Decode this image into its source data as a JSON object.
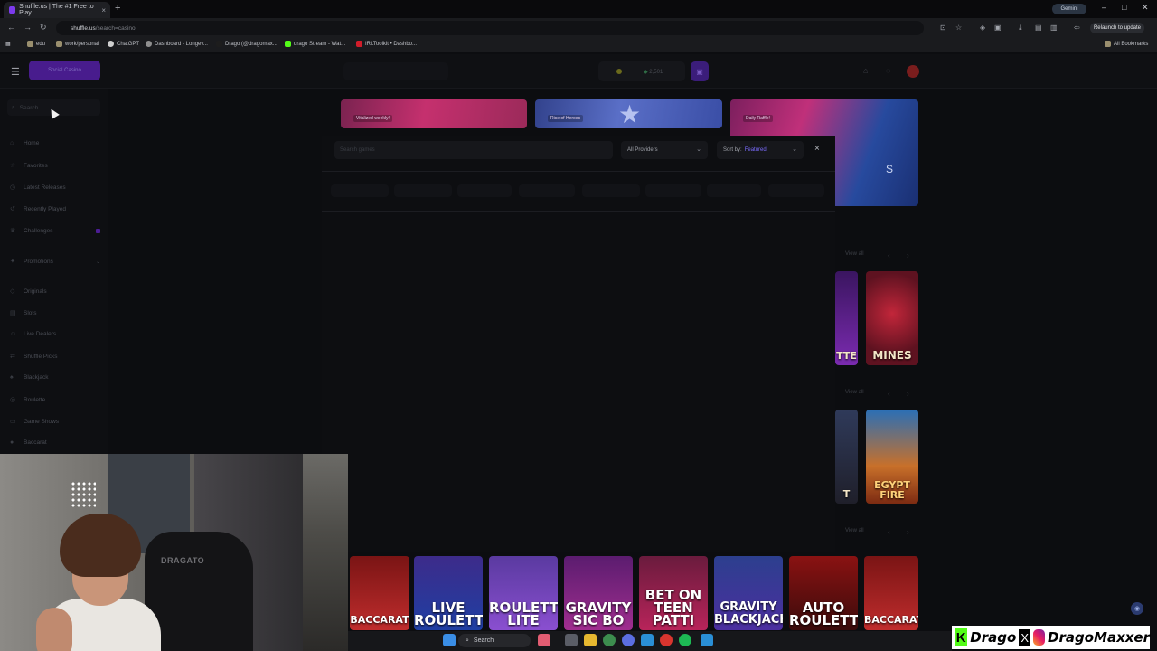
{
  "browser": {
    "tab_title": "Shuffle.us | The #1 Free to Play",
    "tab_close": "×",
    "new_tab": "+",
    "gemini": "Gemini",
    "url_host": "shuffle.us",
    "url_path": "/search=casino",
    "relaunch": "Relaunch to update",
    "bookmarks": [
      {
        "label": "edu"
      },
      {
        "label": "work/personal"
      },
      {
        "label": "ChatGPT"
      },
      {
        "label": "Dashboard - Longev..."
      },
      {
        "label": "Drago (@dragomax..."
      },
      {
        "label": "drago Stream - Wat..."
      },
      {
        "label": "IRLToolkit • Dashbo..."
      }
    ],
    "all_bookmarks": "All Bookmarks"
  },
  "header": {
    "social_button": "Social Casino",
    "balance": "2,501"
  },
  "sidebar": {
    "search_placeholder": "Search",
    "items": [
      {
        "label": "Home",
        "icon": "home-icon"
      },
      {
        "label": "Favorites",
        "icon": "star-icon"
      },
      {
        "label": "Latest Releases",
        "icon": "clock-icon"
      },
      {
        "label": "Recently Played",
        "icon": "history-icon"
      },
      {
        "label": "Challenges",
        "icon": "trophy-icon"
      },
      {
        "label": "Promotions",
        "icon": "gift-icon"
      },
      {
        "label": "Originals",
        "icon": "diamond-icon"
      },
      {
        "label": "Slots",
        "icon": "slots-icon"
      },
      {
        "label": "Live Dealers",
        "icon": "dealer-icon"
      },
      {
        "label": "Shuffle Picks",
        "icon": "shuffle-icon"
      },
      {
        "label": "Blackjack",
        "icon": "cards-icon"
      },
      {
        "label": "Roulette",
        "icon": "roulette-icon"
      },
      {
        "label": "Game Shows",
        "icon": "tv-icon"
      },
      {
        "label": "Baccarat",
        "icon": "chip-icon"
      }
    ]
  },
  "banners": [
    {
      "label": "Vitalized weekly!"
    },
    {
      "label": "Rise of Heroes"
    },
    {
      "label": "Daily Raffle!"
    }
  ],
  "search_overlay": {
    "placeholder": "Search games",
    "providers": "All Providers",
    "sort_label": "Sort by:",
    "sort_value": "Featured",
    "close": "×"
  },
  "sections": [
    {
      "view_all": "View all"
    },
    {
      "view_all": "View all"
    },
    {
      "view_all": "View all"
    }
  ],
  "right_tiles": [
    {
      "text": "TTE"
    },
    {
      "text": "MINES"
    },
    {
      "text": "T"
    },
    {
      "text": "EGYPT FIRE"
    }
  ],
  "bottom_tiles": [
    {
      "text": "BACCARAT"
    },
    {
      "text": "LIVE ROULETTE"
    },
    {
      "text": "ROULETTE LITE"
    },
    {
      "text": "GRAVITY SIC BO"
    },
    {
      "text": "BET ON TEEN PATTI"
    },
    {
      "text": "GRAVITY BLACKJACK"
    },
    {
      "text": "AUTO ROULETTE"
    },
    {
      "text": "BACCARAT"
    }
  ],
  "webcam": {
    "chair_text": "DRAGATO"
  },
  "watermark": {
    "kick_letter": "K",
    "kick_name": "Drago",
    "x_glyph": "X",
    "ig_name": "DragoMaxxer"
  },
  "taskbar": {
    "search": "Search"
  },
  "colors": {
    "accent": "#5b21b6",
    "brand_purple": "#7b6cff",
    "kick_green": "#53fc18"
  }
}
